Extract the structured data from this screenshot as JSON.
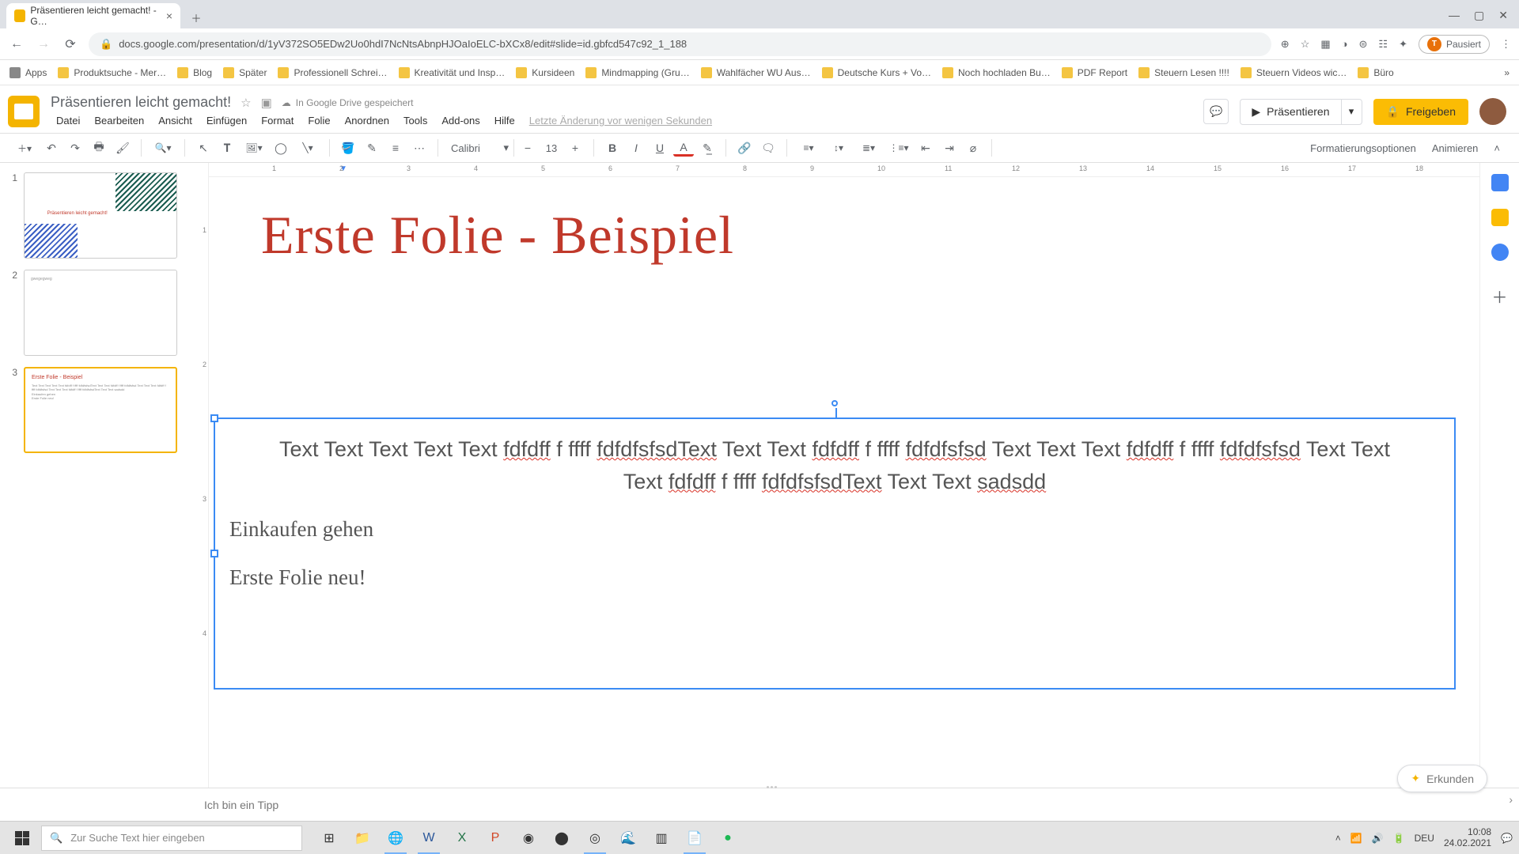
{
  "browser": {
    "tab_title": "Präsentieren leicht gemacht! - G…",
    "url": "docs.google.com/presentation/d/1yV372SO5EDw2Uo0hdI7NcNtsAbnpHJOaIoELC-bXCx8/edit#slide=id.gbfcd547c92_1_188",
    "paused": "Pausiert"
  },
  "bookmarks": [
    "Apps",
    "Produktsuche - Mer…",
    "Blog",
    "Später",
    "Professionell Schrei…",
    "Kreativität und Insp…",
    "Kursideen",
    "Mindmapping (Gru…",
    "Wahlfächer WU Aus…",
    "Deutsche Kurs + Vo…",
    "Noch hochladen Bu…",
    "PDF Report",
    "Steuern Lesen !!!!",
    "Steuern Videos wic…",
    "Büro"
  ],
  "doc": {
    "title": "Präsentieren leicht gemacht!",
    "saved": "In Google Drive gespeichert",
    "menus": [
      "Datei",
      "Bearbeiten",
      "Ansicht",
      "Einfügen",
      "Format",
      "Folie",
      "Anordnen",
      "Tools",
      "Add-ons",
      "Hilfe"
    ],
    "lastchange": "Letzte Änderung vor wenigen Sekunden",
    "present": "Präsentieren",
    "share": "Freigeben"
  },
  "toolbar": {
    "font": "Calibri",
    "fontsize": "13",
    "format_options": "Formatierungsoptionen",
    "animate": "Animieren"
  },
  "ruler_h": [
    "1",
    "2",
    "3",
    "4",
    "5",
    "6",
    "7",
    "8",
    "9",
    "10",
    "11",
    "12",
    "13",
    "14",
    "15",
    "16",
    "17",
    "18"
  ],
  "ruler_v": [
    "1",
    "2",
    "3",
    "4"
  ],
  "thumbs": {
    "t1_title": "Präsentieren leicht gemacht!",
    "t2_text": "gwegegweg",
    "t3_title": "Erste Folie - Beispiel"
  },
  "slide": {
    "title": "Erste Folie - Beispiel",
    "body_line1_parts": [
      "Text Text Text Text Text ",
      "fdfdff",
      " f ffff ",
      "fdfdfsfsdText",
      " Text Text ",
      "fdfdff",
      " f ffff ",
      "fdfdfsfsd",
      " Text Text Text ",
      "fdfdff",
      " f   ffff ",
      "fdfdfsfsd",
      " Text Text Text ",
      "fdfdff",
      " f ffff ",
      "fdfdfsfsdText",
      " Text Text ",
      "sadsdd"
    ],
    "para2": "Einkaufen gehen",
    "para3": "Erste Folie neu!"
  },
  "notes": "Ich bin ein Tipp",
  "explore": "Erkunden",
  "taskbar": {
    "search_placeholder": "Zur Suche Text hier eingeben",
    "lang": "DEU",
    "time": "10:08",
    "date": "24.02.2021"
  }
}
